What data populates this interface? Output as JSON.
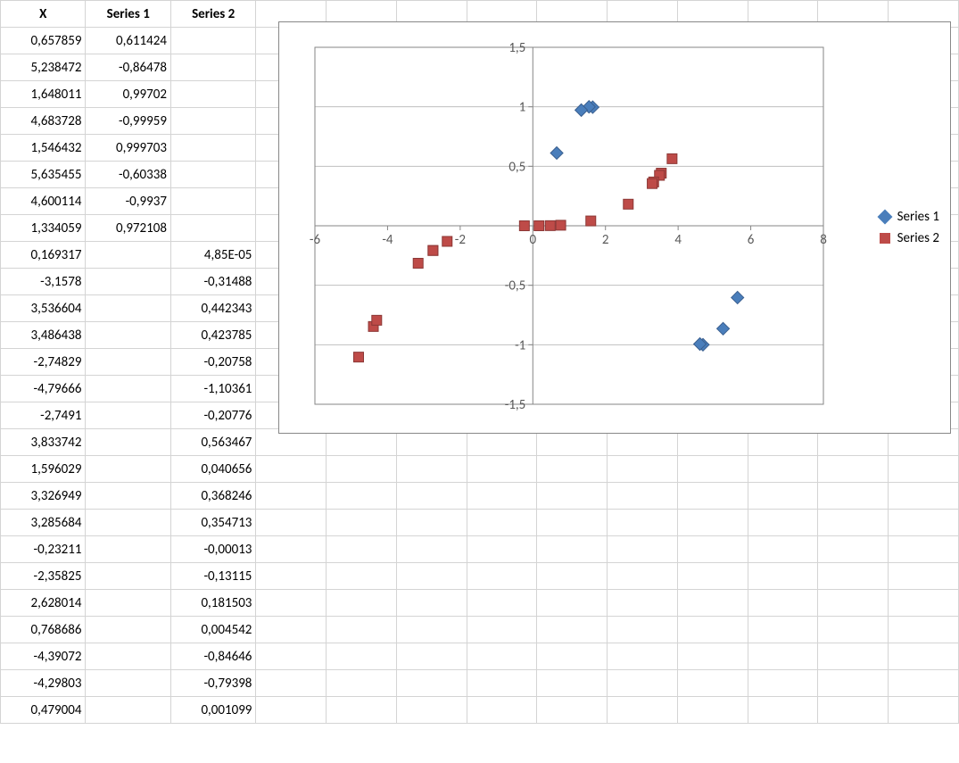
{
  "headers": {
    "x": "X",
    "s1": "Series 1",
    "s2": "Series 2"
  },
  "rows": [
    {
      "x": "0,657859",
      "s1": "0,611424",
      "s2": ""
    },
    {
      "x": "5,238472",
      "s1": "-0,86478",
      "s2": ""
    },
    {
      "x": "1,648011",
      "s1": "0,99702",
      "s2": ""
    },
    {
      "x": "4,683728",
      "s1": "-0,99959",
      "s2": ""
    },
    {
      "x": "1,546432",
      "s1": "0,999703",
      "s2": ""
    },
    {
      "x": "5,635455",
      "s1": "-0,60338",
      "s2": ""
    },
    {
      "x": "4,600114",
      "s1": "-0,9937",
      "s2": ""
    },
    {
      "x": "1,334059",
      "s1": "0,972108",
      "s2": ""
    },
    {
      "x": "0,169317",
      "s1": "",
      "s2": "4,85E-05"
    },
    {
      "x": "-3,1578",
      "s1": "",
      "s2": "-0,31488"
    },
    {
      "x": "3,536604",
      "s1": "",
      "s2": "0,442343"
    },
    {
      "x": "3,486438",
      "s1": "",
      "s2": "0,423785"
    },
    {
      "x": "-2,74829",
      "s1": "",
      "s2": "-0,20758"
    },
    {
      "x": "-4,79666",
      "s1": "",
      "s2": "-1,10361"
    },
    {
      "x": "-2,7491",
      "s1": "",
      "s2": "-0,20776"
    },
    {
      "x": "3,833742",
      "s1": "",
      "s2": "0,563467"
    },
    {
      "x": "1,596029",
      "s1": "",
      "s2": "0,040656"
    },
    {
      "x": "3,326949",
      "s1": "",
      "s2": "0,368246"
    },
    {
      "x": "3,285684",
      "s1": "",
      "s2": "0,354713"
    },
    {
      "x": "-0,23211",
      "s1": "",
      "s2": "-0,00013"
    },
    {
      "x": "-2,35825",
      "s1": "",
      "s2": "-0,13115"
    },
    {
      "x": "2,628014",
      "s1": "",
      "s2": "0,181503"
    },
    {
      "x": "0,768686",
      "s1": "",
      "s2": "0,004542"
    },
    {
      "x": "-4,39072",
      "s1": "",
      "s2": "-0,84646"
    },
    {
      "x": "-4,29803",
      "s1": "",
      "s2": "-0,79398"
    },
    {
      "x": "0,479004",
      "s1": "",
      "s2": "0,001099"
    }
  ],
  "legend": {
    "s1": "Series 1",
    "s2": "Series 2"
  },
  "chart_data": {
    "type": "scatter",
    "xlim": [
      -6,
      8
    ],
    "ylim": [
      -1.5,
      1.5
    ],
    "xticks": [
      -6,
      -4,
      -2,
      0,
      2,
      4,
      6,
      8
    ],
    "yticks": [
      -1.5,
      -1,
      -0.5,
      0,
      0.5,
      1,
      1.5
    ],
    "xlabel": "",
    "ylabel": "",
    "title": "",
    "series": [
      {
        "name": "Series 1",
        "marker": "diamond",
        "color": "#4a7ebb",
        "x": [
          0.657859,
          5.238472,
          1.648011,
          4.683728,
          1.546432,
          5.635455,
          4.600114,
          1.334059
        ],
        "y": [
          0.611424,
          -0.86478,
          0.99702,
          -0.99959,
          0.999703,
          -0.60338,
          -0.9937,
          0.972108
        ]
      },
      {
        "name": "Series 2",
        "marker": "square",
        "color": "#be4b48",
        "x": [
          0.169317,
          -3.1578,
          3.536604,
          3.486438,
          -2.74829,
          -4.79666,
          -2.7491,
          3.833742,
          1.596029,
          3.326949,
          3.285684,
          -0.23211,
          -2.35825,
          2.628014,
          0.768686,
          -4.39072,
          -4.29803,
          0.479004
        ],
        "y": [
          4.85e-05,
          -0.31488,
          0.442343,
          0.423785,
          -0.20758,
          -1.10361,
          -0.20776,
          0.563467,
          0.040656,
          0.368246,
          0.354713,
          -0.00013,
          -0.13115,
          0.181503,
          0.004542,
          -0.84646,
          -0.79398,
          0.001099
        ]
      }
    ]
  }
}
